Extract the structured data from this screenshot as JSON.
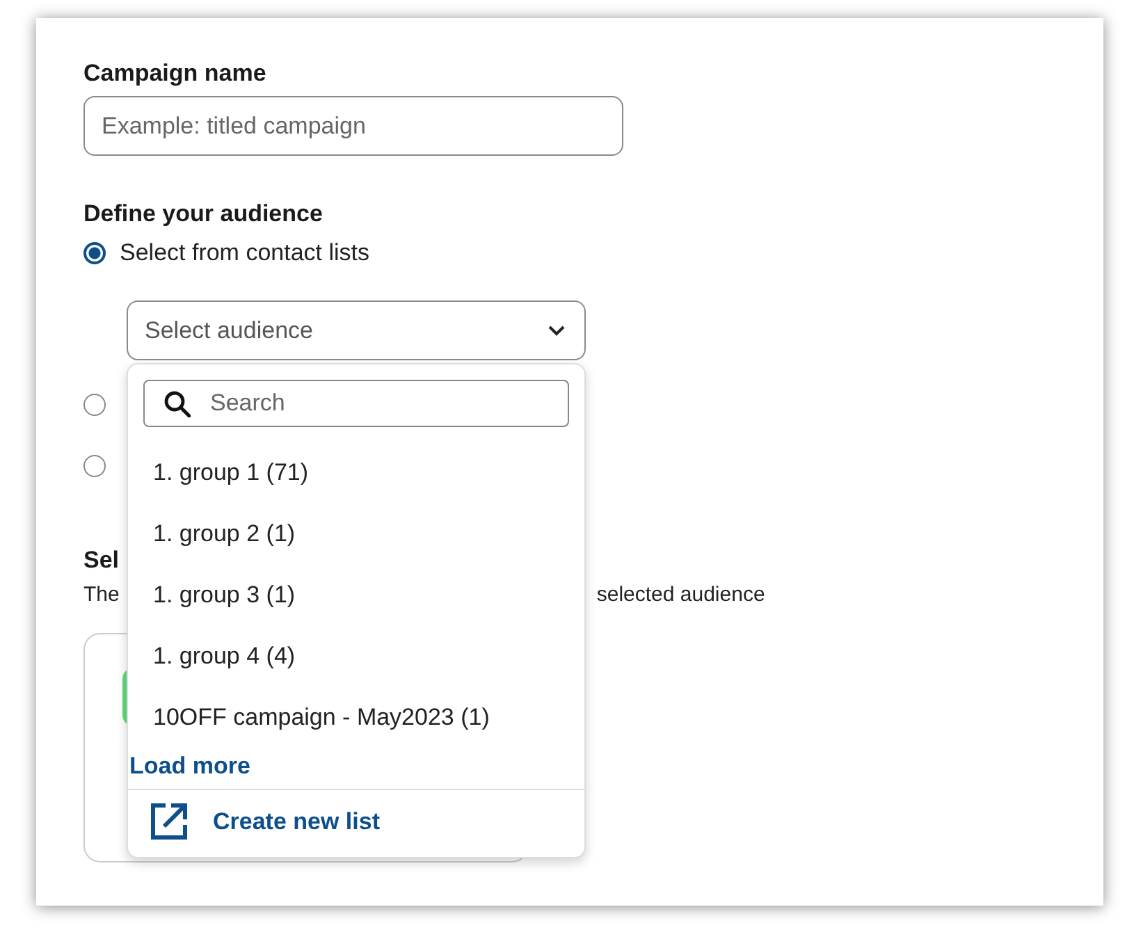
{
  "campaign_name": {
    "label": "Campaign name",
    "placeholder": "Example: titled campaign"
  },
  "audience": {
    "label": "Define your audience",
    "options": [
      {
        "label": "Select from contact lists",
        "selected": true
      },
      {
        "selected": false
      },
      {
        "selected": false
      }
    ],
    "select": {
      "placeholder": "Select audience"
    },
    "dropdown": {
      "search_placeholder": "Search",
      "items": [
        "1. group 1 (71)",
        "1. group 2 (1)",
        "1. group 3 (1)",
        "1. group 4 (4)",
        "10OFF campaign - May2023 (1)"
      ],
      "load_more": "Load more",
      "create_link": "Create new list"
    }
  },
  "section": {
    "title": "Sel",
    "description": "The",
    "description_end": "selected audience"
  }
}
